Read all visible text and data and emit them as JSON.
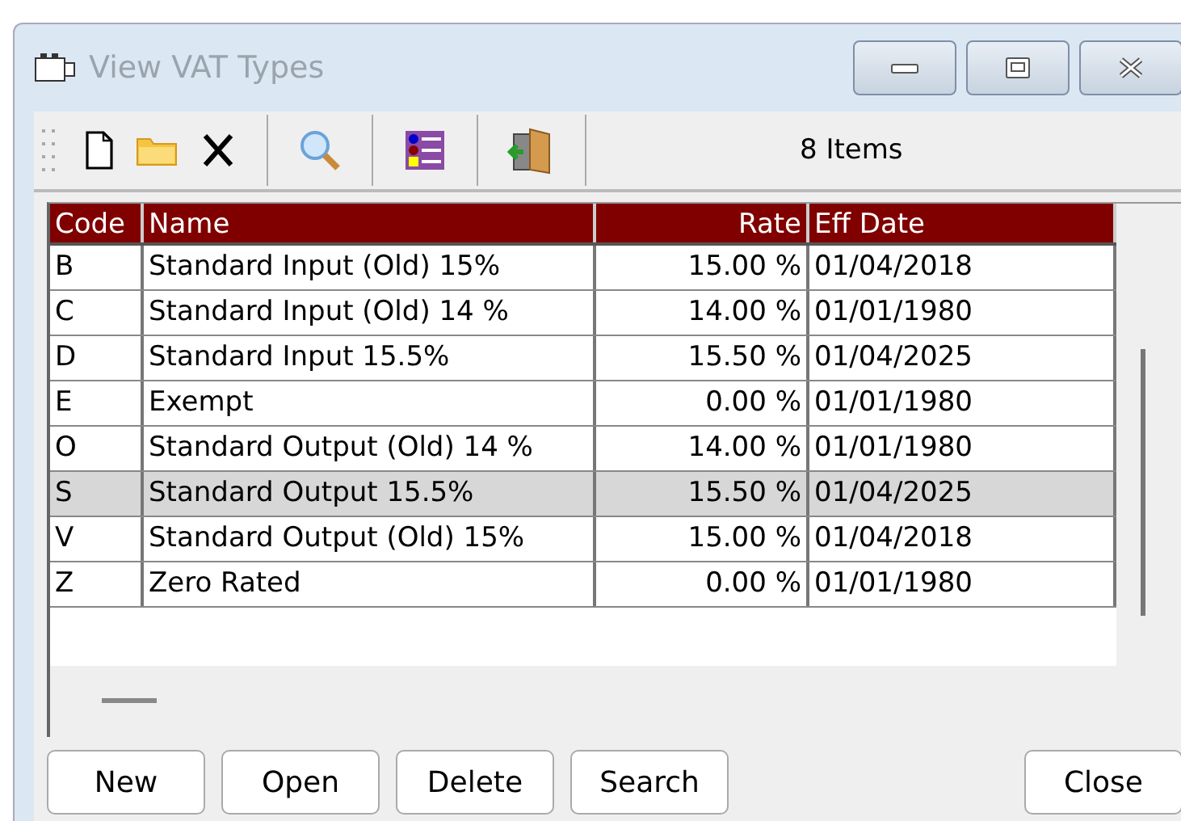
{
  "window": {
    "title": "View VAT Types"
  },
  "toolbar": {
    "item_count": "8 Items"
  },
  "table": {
    "columns": [
      "Code",
      "Name",
      "Rate",
      "Eff Date"
    ],
    "rows": [
      {
        "cells": [
          "B",
          "Standard Input (Old) 15%",
          "15.00 %",
          "01/04/2018"
        ],
        "selected": false
      },
      {
        "cells": [
          "C",
          "Standard Input (Old) 14 %",
          "14.00 %",
          "01/01/1980"
        ],
        "selected": false
      },
      {
        "cells": [
          "D",
          "Standard Input 15.5%",
          "15.50 %",
          "01/04/2025"
        ],
        "selected": false
      },
      {
        "cells": [
          "E",
          "Exempt",
          "0.00 %",
          "01/01/1980"
        ],
        "selected": false
      },
      {
        "cells": [
          "O",
          "Standard Output (Old) 14 %",
          "14.00 %",
          "01/01/1980"
        ],
        "selected": false
      },
      {
        "cells": [
          "S",
          "Standard Output 15.5%",
          "15.50 %",
          "01/04/2025"
        ],
        "selected": true
      },
      {
        "cells": [
          "V",
          "Standard Output (Old) 15%",
          "15.00 %",
          "01/04/2018"
        ],
        "selected": false
      },
      {
        "cells": [
          "Z",
          "Zero Rated",
          "0.00 %",
          "01/01/1980"
        ],
        "selected": false
      }
    ]
  },
  "buttons": [
    {
      "label": "New",
      "kind": "left"
    },
    {
      "label": "Open",
      "kind": "left"
    },
    {
      "label": "Delete",
      "kind": "left"
    },
    {
      "label": "Search",
      "kind": "left"
    },
    {
      "label": "Close",
      "kind": "right"
    }
  ]
}
